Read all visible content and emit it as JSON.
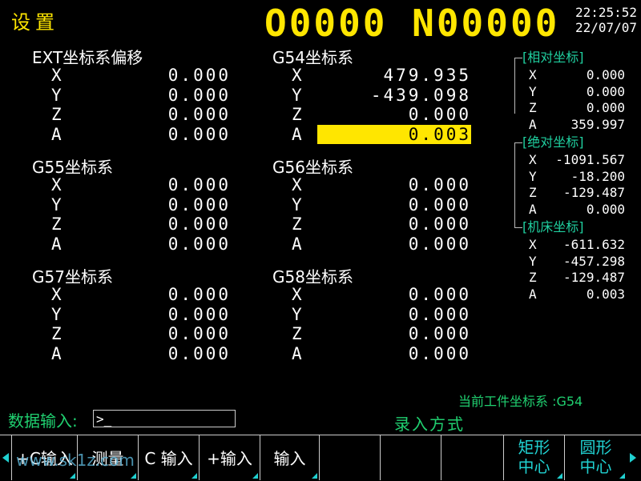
{
  "header": {
    "title": "设置",
    "program": "O0000 N00000",
    "time": "22:25:52",
    "date": "22/07/07"
  },
  "blocks": [
    {
      "id": "ext",
      "title": "EXT坐标系偏移",
      "rows": [
        {
          "axis": "X",
          "value": "0.000"
        },
        {
          "axis": "Y",
          "value": "0.000"
        },
        {
          "axis": "Z",
          "value": "0.000"
        },
        {
          "axis": "A",
          "value": "0.000"
        }
      ]
    },
    {
      "id": "g54",
      "title": "G54坐标系",
      "rows": [
        {
          "axis": "X",
          "value": "479.935"
        },
        {
          "axis": "Y",
          "value": "-439.098"
        },
        {
          "axis": "Z",
          "value": "0.000"
        },
        {
          "axis": "A",
          "value": "0.003"
        }
      ]
    },
    {
      "id": "g55",
      "title": "G55坐标系",
      "rows": [
        {
          "axis": "X",
          "value": "0.000"
        },
        {
          "axis": "Y",
          "value": "0.000"
        },
        {
          "axis": "Z",
          "value": "0.000"
        },
        {
          "axis": "A",
          "value": "0.000"
        }
      ]
    },
    {
      "id": "g56",
      "title": "G56坐标系",
      "rows": [
        {
          "axis": "X",
          "value": "0.000"
        },
        {
          "axis": "Y",
          "value": "0.000"
        },
        {
          "axis": "Z",
          "value": "0.000"
        },
        {
          "axis": "A",
          "value": "0.000"
        }
      ]
    },
    {
      "id": "g57",
      "title": "G57坐标系",
      "rows": [
        {
          "axis": "X",
          "value": "0.000"
        },
        {
          "axis": "Y",
          "value": "0.000"
        },
        {
          "axis": "Z",
          "value": "0.000"
        },
        {
          "axis": "A",
          "value": "0.000"
        }
      ]
    },
    {
      "id": "g58",
      "title": "G58坐标系",
      "rows": [
        {
          "axis": "X",
          "value": "0.000"
        },
        {
          "axis": "Y",
          "value": "0.000"
        },
        {
          "axis": "Z",
          "value": "0.000"
        },
        {
          "axis": "A",
          "value": "0.000"
        }
      ]
    }
  ],
  "right_panel": {
    "relative": {
      "title": "[相对坐标]",
      "rows": [
        {
          "axis": "X",
          "value": "0.000"
        },
        {
          "axis": "Y",
          "value": "0.000"
        },
        {
          "axis": "Z",
          "value": "0.000"
        },
        {
          "axis": "A",
          "value": "359.997"
        }
      ]
    },
    "absolute": {
      "title": "[绝对坐标]",
      "rows": [
        {
          "axis": "X",
          "value": "-1091.567"
        },
        {
          "axis": "Y",
          "value": "-18.200"
        },
        {
          "axis": "Z",
          "value": "-129.487"
        },
        {
          "axis": "A",
          "value": "0.000"
        }
      ]
    },
    "machine": {
      "title": "[机床坐标]",
      "rows": [
        {
          "axis": "X",
          "value": "-611.632"
        },
        {
          "axis": "Y",
          "value": "-457.298"
        },
        {
          "axis": "Z",
          "value": "-129.487"
        },
        {
          "axis": "A",
          "value": "0.003"
        }
      ]
    }
  },
  "status": {
    "current_wcs": "当前工件坐标系 :G54",
    "input_label": "数据输入:",
    "input_value": ">_",
    "mode": "录入方式"
  },
  "softkeys": [
    "+C输入",
    "测量",
    "C 输入",
    "+输入",
    "输入",
    "",
    "",
    "",
    "矩形\n中心",
    "圆形\n中心"
  ],
  "watermark": "www.sk1z.com",
  "colors": {
    "accent": "#ffe600",
    "label": "#20d070",
    "frame": "#20d0d0"
  }
}
